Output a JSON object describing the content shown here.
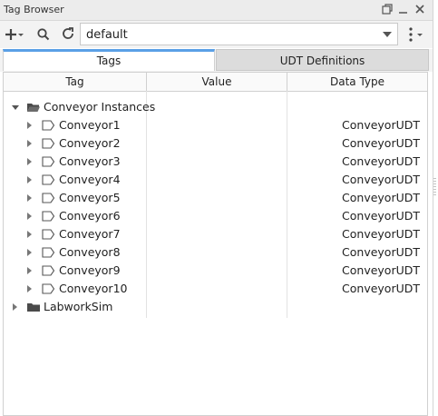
{
  "window": {
    "title": "Tag Browser"
  },
  "toolbar": {
    "provider_value": "default"
  },
  "tabs": [
    {
      "label": "Tags",
      "active": true
    },
    {
      "label": "UDT Definitions",
      "active": false
    }
  ],
  "columns": {
    "tag": "Tag",
    "value": "Value",
    "data_type": "Data Type"
  },
  "tree": {
    "folder": {
      "label": "Conveyor Instances",
      "expanded": true
    },
    "items": [
      {
        "name": "Conveyor1",
        "data_type": "ConveyorUDT"
      },
      {
        "name": "Conveyor2",
        "data_type": "ConveyorUDT"
      },
      {
        "name": "Conveyor3",
        "data_type": "ConveyorUDT"
      },
      {
        "name": "Conveyor4",
        "data_type": "ConveyorUDT"
      },
      {
        "name": "Conveyor5",
        "data_type": "ConveyorUDT"
      },
      {
        "name": "Conveyor6",
        "data_type": "ConveyorUDT"
      },
      {
        "name": "Conveyor7",
        "data_type": "ConveyorUDT"
      },
      {
        "name": "Conveyor8",
        "data_type": "ConveyorUDT"
      },
      {
        "name": "Conveyor9",
        "data_type": "ConveyorUDT"
      },
      {
        "name": "Conveyor10",
        "data_type": "ConveyorUDT"
      }
    ],
    "sibling_folder": {
      "label": "LabworkSim",
      "expanded": false
    }
  },
  "colors": {
    "accent": "#5aa0e6",
    "folder": "#4a4a4a"
  }
}
